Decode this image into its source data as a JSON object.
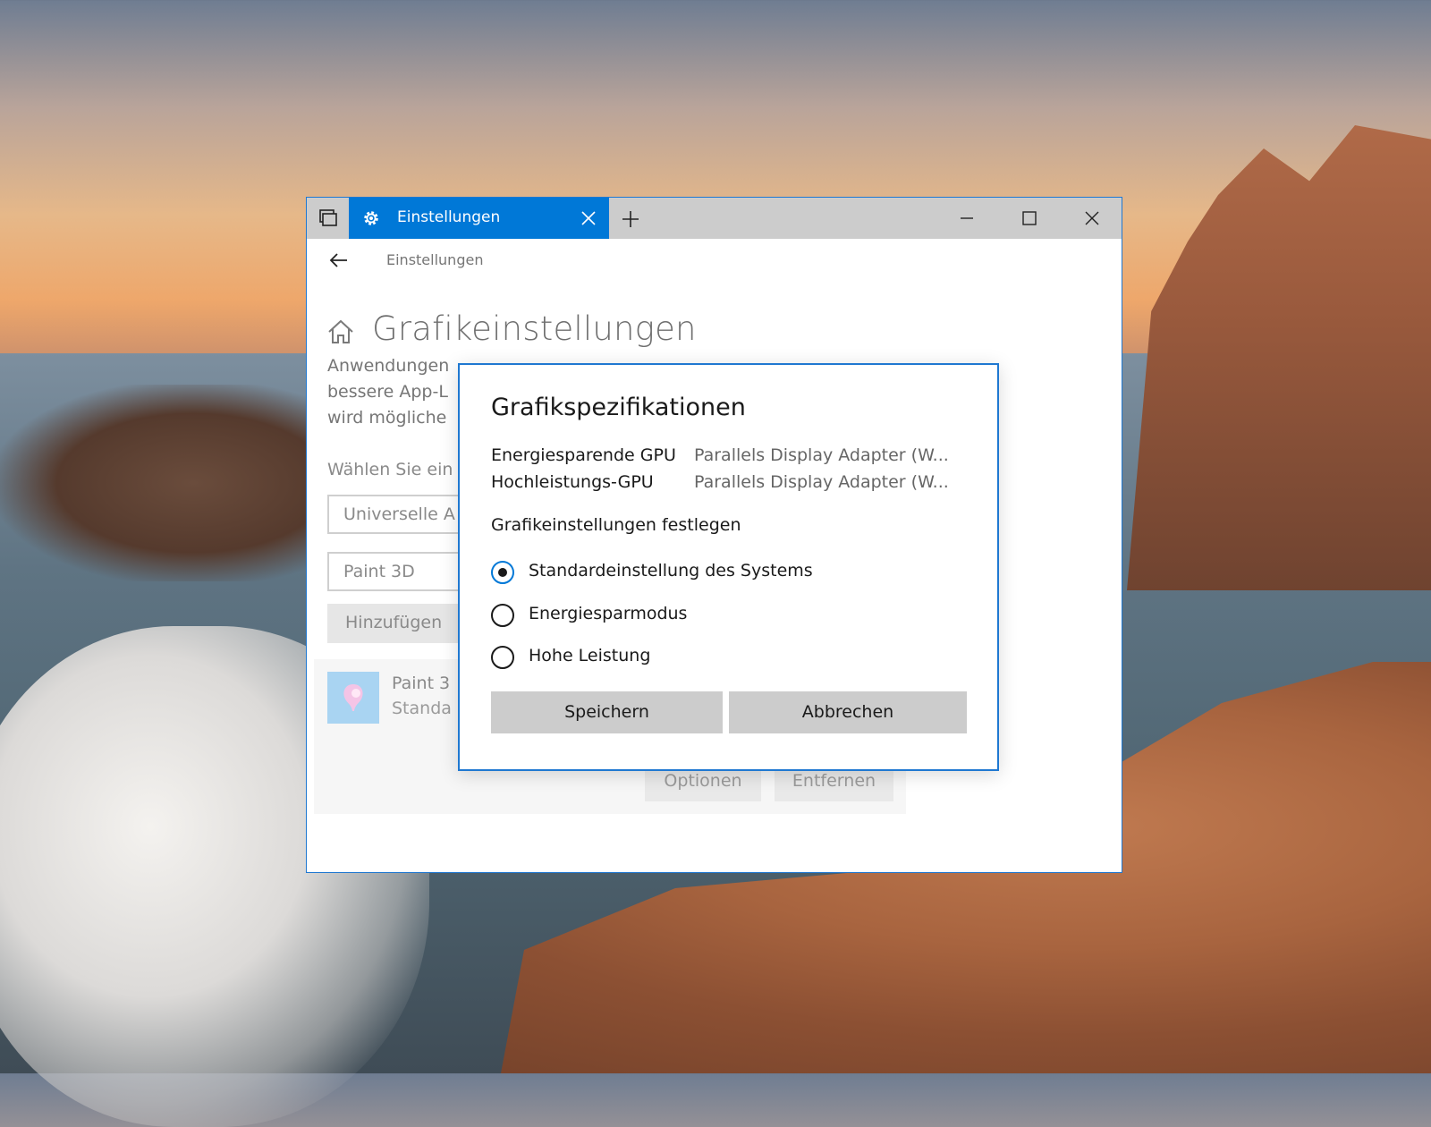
{
  "window": {
    "tab_title": "Einstellungen",
    "breadcrumb": "Einstellungen",
    "page_title": "Grafikeinstellungen"
  },
  "background_page": {
    "description_lines": [
      "Anwendungen",
      "bessere App-L",
      "wird mögliche"
    ],
    "choose_label": "Wählen Sie ein",
    "select_value": "Universelle A",
    "input_value": "Paint 3D",
    "add_button": "Hinzufügen",
    "app": {
      "name": "Paint 3",
      "subtitle": "Standa"
    },
    "options_button": "Optionen",
    "remove_button": "Entfernen"
  },
  "dialog": {
    "title": "Grafikspezifikationen",
    "specs": [
      {
        "label": "Energiesparende GPU",
        "value": "Parallels Display Adapter (W..."
      },
      {
        "label": "Hochleistungs-GPU",
        "value": "Parallels Display Adapter (W..."
      }
    ],
    "settings_label": "Grafikeinstellungen festlegen",
    "options": [
      {
        "label": "Standardeinstellung des Systems",
        "checked": true
      },
      {
        "label": "Energiesparmodus",
        "checked": false
      },
      {
        "label": "Hohe Leistung",
        "checked": false
      }
    ],
    "save_button": "Speichern",
    "cancel_button": "Abbrechen"
  },
  "colors": {
    "accent": "#0078d7",
    "titlebar": "#cccccc"
  },
  "icons": [
    "tabs-icon",
    "gear-icon",
    "close-icon",
    "plus-icon",
    "minimize-icon",
    "maximize-icon",
    "back-arrow-icon",
    "home-icon",
    "paint3d-icon"
  ]
}
